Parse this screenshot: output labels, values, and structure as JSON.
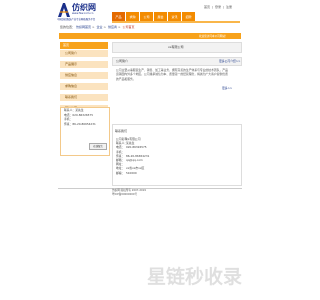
{
  "header": {
    "logo_name": "仿织网",
    "logo_url": "www.fzw.com.cn",
    "logo_slogan": "中国纺织服装产业专业网络服务平台",
    "top_links": [
      "首页",
      "|",
      "登录",
      "|",
      "注册"
    ],
    "nav": [
      "产品",
      "求购",
      "公司",
      "展会",
      "资讯",
      "招聘"
    ]
  },
  "breadcrumb": {
    "prefix": "您的位置：",
    "items": [
      "仿织网首页",
      "企业",
      "供应商",
      "公司首页"
    ],
    "current": "公司首页"
  },
  "orange_bar_text": "欢迎您访问本公司网站！",
  "sidebar": {
    "head": "首页",
    "items": [
      "公司简介",
      "产品展示",
      "供应信息",
      "求购信息",
      "联系我们",
      "网站地图"
    ],
    "contact": {
      "lines": [
        "联系人：某先生",
        "电话：020-86326575",
        "手机：",
        "传真：86-20-86654231"
      ],
      "button": "在线留言"
    }
  },
  "main": {
    "company_title": "xx有限公司",
    "intro_label": "公司简介",
    "intro_more": "更多公司介绍>>",
    "intro_text": "公司主要从事服装生产、销售、加工等业务，拥有完善的生产体系与专业的技术团队，产品远销国内外多个地区。公司秉承诚信为本、质量第一的经营理念，竭诚为广大客户提供优质的产品和服务。",
    "more_link": "更多>>",
    "contact_title": "联系我们",
    "contact_rows": [
      {
        "label": "公司名称：",
        "value": "xx有限公司"
      },
      {
        "label": "联系人：",
        "value": "某先生"
      },
      {
        "label": "电话：",
        "value": "020-86326575"
      },
      {
        "label": "手机：",
        "value": ""
      },
      {
        "label": "传真：",
        "value": "86-20-86654231"
      },
      {
        "label": "邮箱：",
        "value": "qq@qq.com"
      },
      {
        "label": "网址：",
        "value": ""
      },
      {
        "label": "地址：",
        "value": "xx省xx市xx区"
      },
      {
        "label": "邮编：",
        "value": "510000"
      }
    ]
  },
  "footer": {
    "lines": [
      "仿织网 版权所有 2007-2019",
      "粤ICP备00000000号"
    ]
  },
  "watermark": "星链秒收录"
}
